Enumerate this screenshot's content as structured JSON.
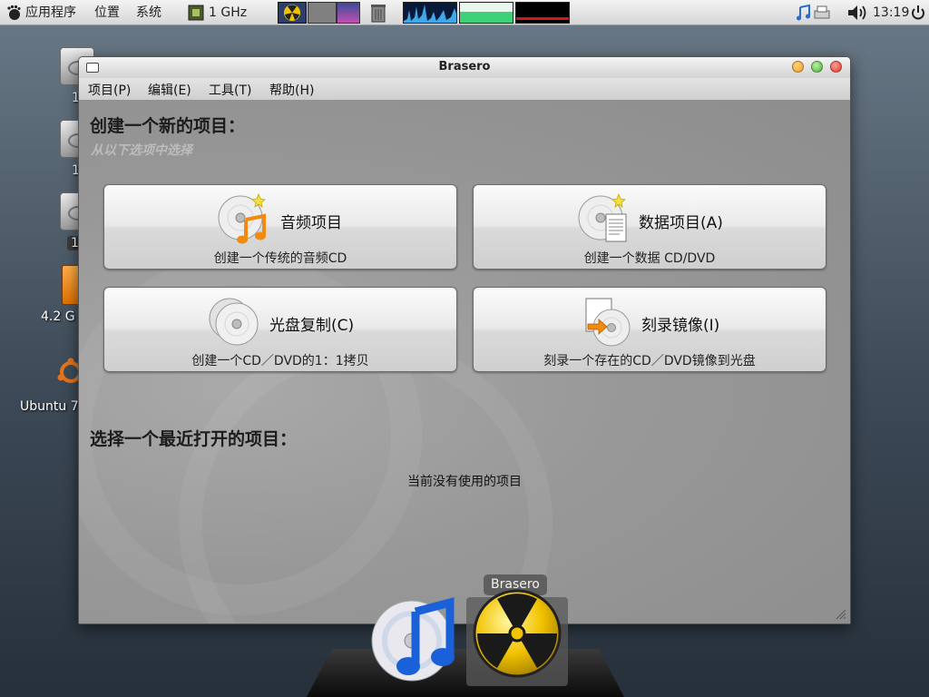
{
  "top_panel": {
    "menus": [
      "应用程序",
      "位置",
      "系统"
    ],
    "cpu_freq": "1 GHz",
    "clock": "13:19"
  },
  "desktop": {
    "icons": [
      {
        "label": "1"
      },
      {
        "label": "1"
      },
      {
        "label": "1"
      },
      {
        "label": "4.2 G"
      },
      {
        "label": "Ubuntu 7"
      }
    ]
  },
  "window": {
    "title": "Brasero",
    "menubar": [
      "项目(P)",
      "编辑(E)",
      "工具(T)",
      "帮助(H)"
    ],
    "heading": "创建一个新的项目：",
    "subheading": "从以下选项中选择",
    "projects": [
      {
        "title": "音频项目",
        "description": "创建一个传统的音频CD",
        "icon": "audio-cd-icon"
      },
      {
        "title": "数据项目(A)",
        "description": "创建一个数据  CD/DVD",
        "icon": "data-disc-icon"
      },
      {
        "title": "光盘复制(C)",
        "description": "创建一个CD／DVD的1：1拷贝",
        "icon": "disc-copy-icon"
      },
      {
        "title": "刻录镜像(I)",
        "description": "刻录一个存在的CD／DVD镜像到光盘",
        "icon": "burn-image-icon"
      }
    ],
    "recent_heading": "选择一个最近打开的项目：",
    "recent_empty": "当前没有使用的项目"
  },
  "dock": {
    "tooltip": "Brasero",
    "items": [
      {
        "icon": "itunes-icon"
      },
      {
        "icon": "brasero-icon"
      }
    ]
  },
  "colors": {
    "radiation_yellow": "#f2c200",
    "close_red": "#e03a2e",
    "maximize_green": "#4cb43c",
    "minimize_orange": "#f0a020"
  }
}
